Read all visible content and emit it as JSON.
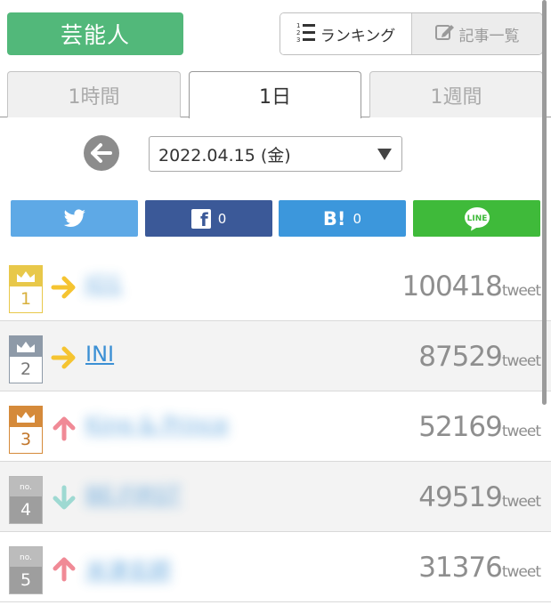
{
  "header": {
    "category": "芸能人",
    "ranking_label": "ランキング",
    "articles_label": "記事一覧",
    "ranking_icon": "numbered-list-icon",
    "articles_icon": "edit-icon"
  },
  "tabs": [
    {
      "label": "1時間",
      "active": false
    },
    {
      "label": "1日",
      "active": true
    },
    {
      "label": "1週間",
      "active": false
    }
  ],
  "date": {
    "selected": "2022.04.15 (金)"
  },
  "share": {
    "twitter_icon": "twitter-icon",
    "facebook_count": "0",
    "hatena_label": "B!",
    "hatena_count": "0",
    "line_label": "LINE"
  },
  "ranking": [
    {
      "rank": "1",
      "name": "JO1",
      "trend": "same",
      "count": "100418",
      "unit": "tweet"
    },
    {
      "rank": "2",
      "name": "INI",
      "trend": "same",
      "count": "87529",
      "unit": "tweet"
    },
    {
      "rank": "3",
      "name": "King & Prince",
      "trend": "up",
      "count": "52169",
      "unit": "tweet"
    },
    {
      "rank": "4",
      "name": "BE:FIRST",
      "trend": "down",
      "count": "49519",
      "unit": "tweet"
    },
    {
      "rank": "5",
      "name": "米津玄師",
      "trend": "up",
      "count": "31376",
      "unit": "tweet"
    }
  ],
  "badge_text": "no.",
  "colors": {
    "category_green": "#52b87a",
    "gold": "#e8c84a",
    "silver": "#8e9aa8",
    "bronze": "#d58a3a",
    "arrow_same": "#f5c431",
    "arrow_up": "#f08a96",
    "arrow_down": "#9ed9d2",
    "link_blue": "#3b8fd4"
  }
}
